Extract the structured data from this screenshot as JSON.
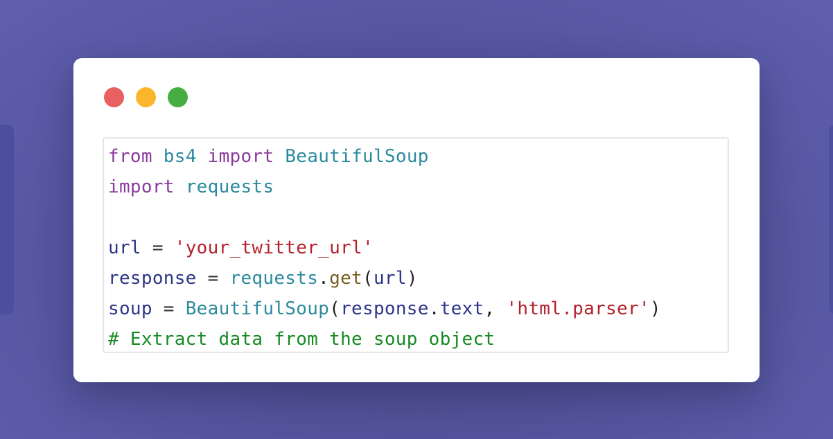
{
  "window": {
    "controls": [
      {
        "name": "close",
        "color": "#e96060"
      },
      {
        "name": "minimize",
        "color": "#fbb62c"
      },
      {
        "name": "maximize",
        "color": "#45ad42"
      }
    ]
  },
  "code": {
    "language": "python",
    "lines": [
      [
        {
          "t": "from",
          "c": "kw"
        },
        {
          "t": " ",
          "c": "op"
        },
        {
          "t": "bs4",
          "c": "mod"
        },
        {
          "t": " ",
          "c": "op"
        },
        {
          "t": "import",
          "c": "kw"
        },
        {
          "t": " ",
          "c": "op"
        },
        {
          "t": "BeautifulSoup",
          "c": "mod"
        }
      ],
      [
        {
          "t": "import",
          "c": "kw"
        },
        {
          "t": " ",
          "c": "op"
        },
        {
          "t": "requests",
          "c": "mod"
        }
      ],
      [],
      [
        {
          "t": "url",
          "c": "var"
        },
        {
          "t": " = ",
          "c": "op"
        },
        {
          "t": "'your_twitter_url'",
          "c": "str"
        }
      ],
      [
        {
          "t": "response",
          "c": "var"
        },
        {
          "t": " = ",
          "c": "op"
        },
        {
          "t": "requests",
          "c": "mod"
        },
        {
          "t": ".",
          "c": "punc"
        },
        {
          "t": "get",
          "c": "fn"
        },
        {
          "t": "(",
          "c": "punc"
        },
        {
          "t": "url",
          "c": "var"
        },
        {
          "t": ")",
          "c": "punc"
        }
      ],
      [
        {
          "t": "soup",
          "c": "var"
        },
        {
          "t": " = ",
          "c": "op"
        },
        {
          "t": "BeautifulSoup",
          "c": "mod"
        },
        {
          "t": "(",
          "c": "punc"
        },
        {
          "t": "response",
          "c": "var"
        },
        {
          "t": ".",
          "c": "punc"
        },
        {
          "t": "text",
          "c": "var"
        },
        {
          "t": ", ",
          "c": "punc"
        },
        {
          "t": "'html.parser'",
          "c": "str"
        },
        {
          "t": ")",
          "c": "punc"
        }
      ],
      [
        {
          "t": "# Extract data from the soup object",
          "c": "cmt"
        }
      ]
    ]
  }
}
